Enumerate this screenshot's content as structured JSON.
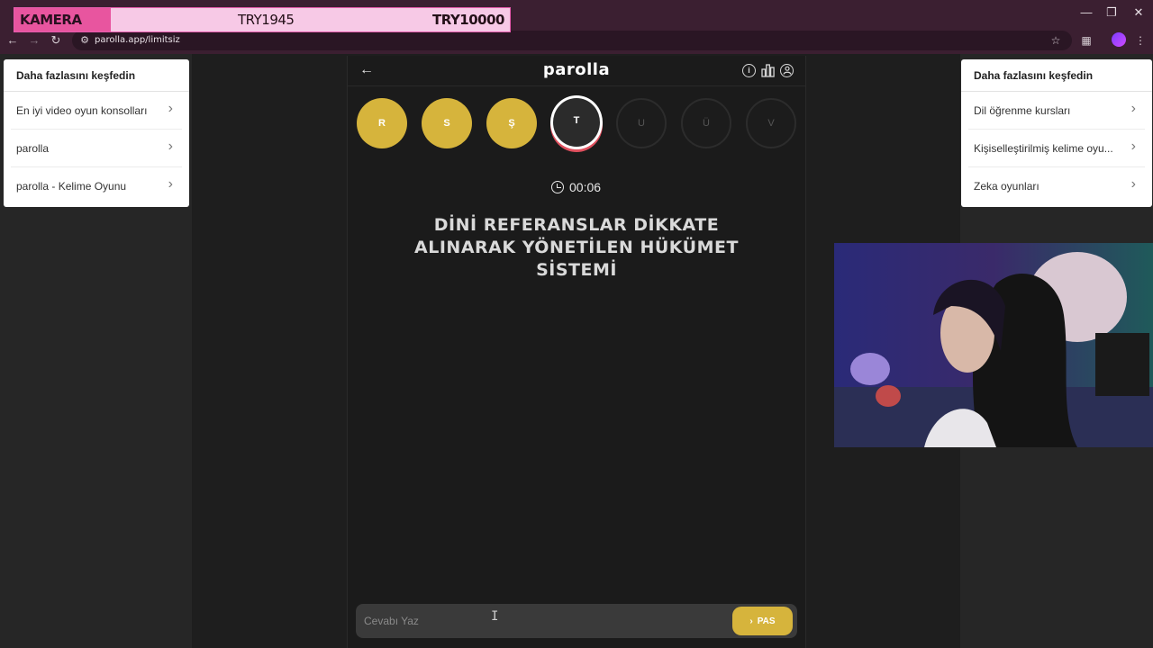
{
  "browser": {
    "url": "parolla.app/limitsiz"
  },
  "overlay": {
    "label": "KAMERA",
    "current": "TRY1945",
    "goal": "TRY10000"
  },
  "left_panel": {
    "title": "Daha fazlasını keşfedin",
    "items": [
      {
        "label": "En iyi video oyun konsolları"
      },
      {
        "label": "parolla"
      },
      {
        "label": "parolla - Kelime Oyunu"
      }
    ]
  },
  "right_panel": {
    "title": "Daha fazlasını keşfedin",
    "items": [
      {
        "label": "Dil öğrenme kursları"
      },
      {
        "label": "Kişiselleştirilmiş kelime oyu..."
      },
      {
        "label": "Zeka oyunları"
      }
    ]
  },
  "game": {
    "brand": "parolla",
    "letters": [
      {
        "char": "R",
        "state": "done"
      },
      {
        "char": "S",
        "state": "done"
      },
      {
        "char": "Ş",
        "state": "done"
      },
      {
        "char": "T",
        "state": "active"
      },
      {
        "char": "U",
        "state": "pending"
      },
      {
        "char": "Ü",
        "state": "pending"
      },
      {
        "char": "V",
        "state": "pending"
      }
    ],
    "timer": "00:06",
    "question": "DİNİ REFERANSLAR DİKKATE ALINARAK YÖNETİLEN HÜKÜMET SİSTEMİ",
    "answer_placeholder": "Cevabı Yaz",
    "pass_label": "PAS"
  },
  "colors": {
    "accent_yellow": "#d6b43c",
    "browser_frame": "#3b1f31",
    "overlay_pink": "#f7c9e6"
  }
}
